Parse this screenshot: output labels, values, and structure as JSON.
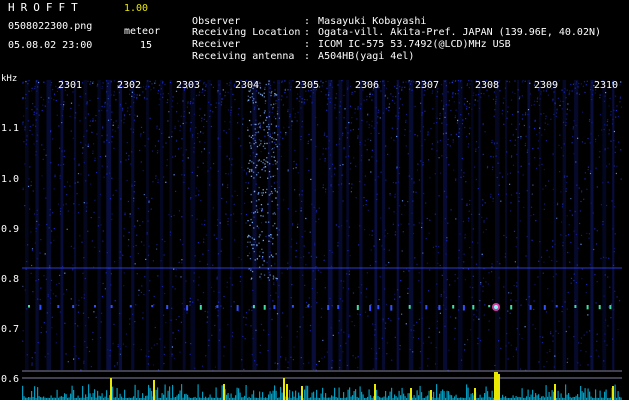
{
  "header": {
    "app_title_letters": "HROFFT",
    "version": "1.00",
    "filename": "0508022300.png",
    "datetime": "05.08.02 23:00",
    "meteor_label": "meteor",
    "meteor_count": "15"
  },
  "info": [
    {
      "key": "Observer",
      "value": "Masayuki Kobayashi"
    },
    {
      "key": "Receiving Location",
      "value": "Ogata-vill. Akita-Pref. JAPAN (139.96E, 40.02N)"
    },
    {
      "key": "Receiver",
      "value": "ICOM IC-575 53.7492(@LCD)MHz USB"
    },
    {
      "key": "Receiving antenna",
      "value": "A504HB(yagi 4el)"
    }
  ],
  "axis": {
    "y_unit": "kHz",
    "y_ticks": [
      "1.1",
      "1.0",
      "0.9",
      "0.8",
      "0.7",
      "0.6"
    ],
    "x_ticks": [
      "2301",
      "2302",
      "2303",
      "2304",
      "2305",
      "2306",
      "2307",
      "2308",
      "2309",
      "2310"
    ]
  },
  "colors": {
    "background": "#000000",
    "noise": "#1a2cc8",
    "marker_line": "#2a3cd8",
    "baseline": "#8080a0",
    "echo": "#e8e800",
    "activity": "#00d0ff"
  }
}
